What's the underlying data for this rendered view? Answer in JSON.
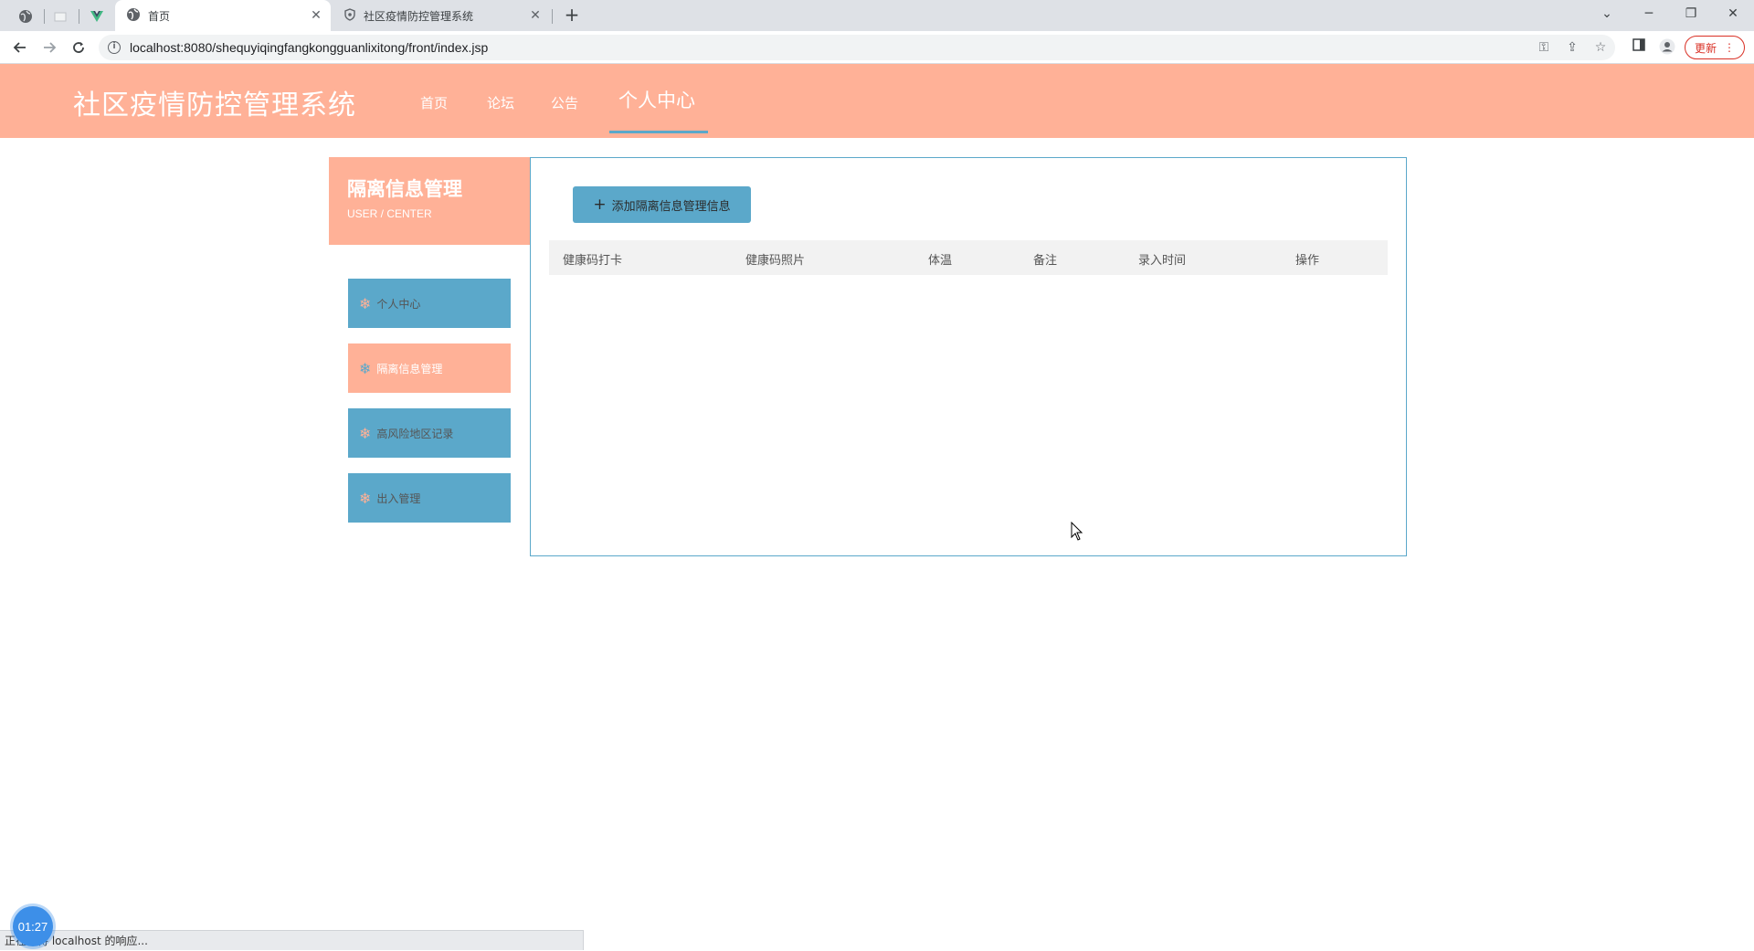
{
  "browser": {
    "tabs": [
      {
        "title": "首页",
        "active": true
      },
      {
        "title": "社区疫情防控管理系统",
        "active": false
      }
    ],
    "url": "localhost:8080/shequyiqingfangkongguanlixitong/front/index.jsp",
    "update_label": "更新",
    "status_text": "正在等待 localhost 的响应..."
  },
  "header": {
    "title": "社区疫情防控管理系统",
    "nav": [
      {
        "label": "首页"
      },
      {
        "label": "论坛"
      },
      {
        "label": "公告"
      },
      {
        "label": "个人中心",
        "active": true
      }
    ]
  },
  "sidebar": {
    "title": "隔离信息管理",
    "subtitle": "USER / CENTER",
    "items": [
      {
        "label": "个人中心",
        "active": false
      },
      {
        "label": "隔离信息管理",
        "active": true
      },
      {
        "label": "高风险地区记录",
        "active": false
      },
      {
        "label": "出入管理",
        "active": false
      }
    ]
  },
  "main": {
    "add_button_label": "添加隔离信息管理信息",
    "table_headers": [
      "健康码打卡",
      "健康码照片",
      "体温",
      "备注",
      "录入时间",
      "操作"
    ]
  },
  "timer": "01:27",
  "colors": {
    "accent_peach": "#ffb197",
    "accent_blue": "#5ba8ca",
    "update_red": "#d93025"
  }
}
